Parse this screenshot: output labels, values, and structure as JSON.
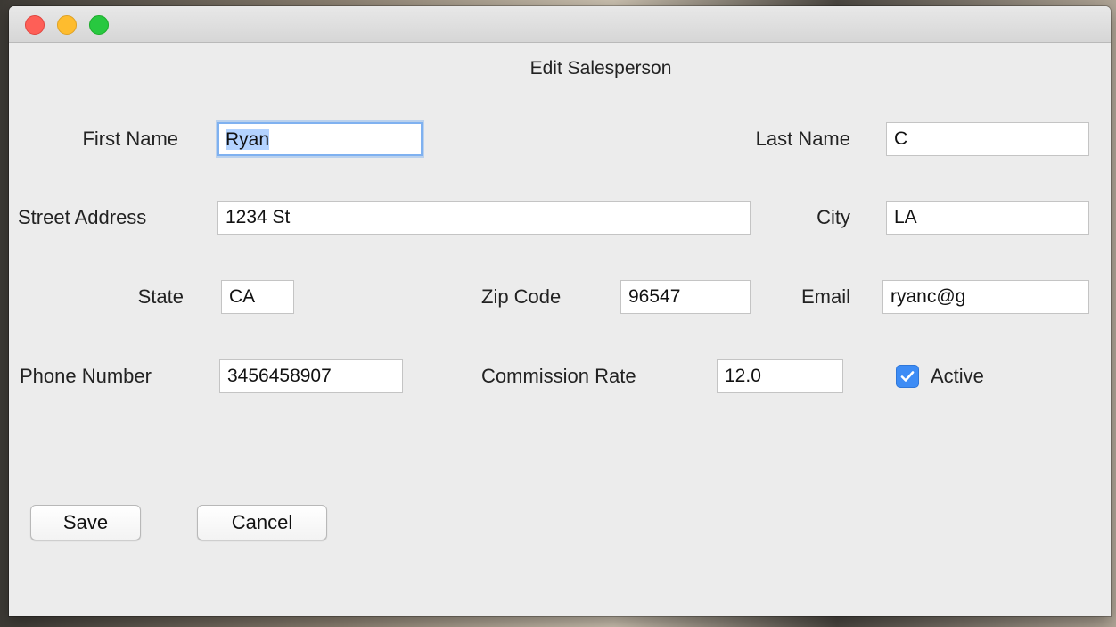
{
  "window": {
    "title": "Edit Salesperson"
  },
  "form": {
    "first_name": {
      "label": "First Name",
      "value": "Ryan"
    },
    "last_name": {
      "label": "Last Name",
      "value": "C"
    },
    "street_address": {
      "label": "Street Address",
      "value": "1234 St"
    },
    "city": {
      "label": "City",
      "value": "LA"
    },
    "state": {
      "label": "State",
      "value": "CA"
    },
    "zip_code": {
      "label": "Zip Code",
      "value": "96547"
    },
    "email": {
      "label": "Email",
      "value": "ryanc@g"
    },
    "phone_number": {
      "label": "Phone Number",
      "value": "3456458907"
    },
    "commission_rate": {
      "label": "Commission Rate",
      "value": "12.0"
    },
    "active": {
      "label": "Active",
      "checked": true
    }
  },
  "buttons": {
    "save": "Save",
    "cancel": "Cancel"
  },
  "colors": {
    "accent": "#3d8cf5",
    "focus_ring": "#7fb1f0",
    "selection": "#b3d3ff"
  }
}
